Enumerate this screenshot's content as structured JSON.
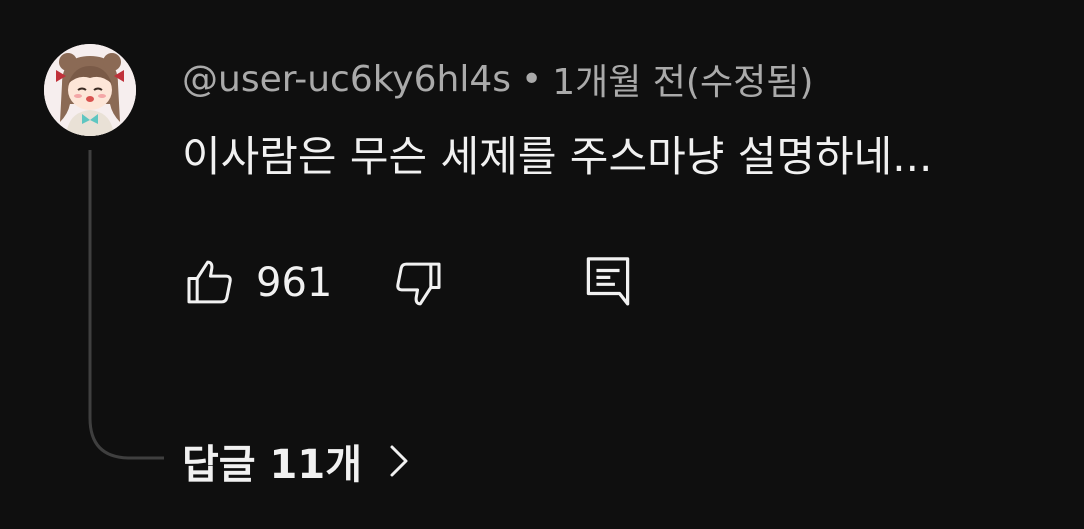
{
  "comment": {
    "author": "@user-uc6ky6hl4s",
    "separator": "•",
    "timestamp": "1개월 전(수정됨)",
    "text": "이사람은 무슨 세제를 주스마냥 설명하네...",
    "likes": "961"
  },
  "replies": {
    "label": "답글 11개"
  },
  "icons": {
    "like": "thumbs-up-icon",
    "dislike": "thumbs-down-icon",
    "reply": "comment-reply-icon",
    "expand": "chevron-right-icon"
  },
  "colors": {
    "background": "#0f0f0f",
    "text_primary": "#f1f1f1",
    "text_secondary": "#aaaaaa",
    "thread_line": "#3f3f3f"
  }
}
